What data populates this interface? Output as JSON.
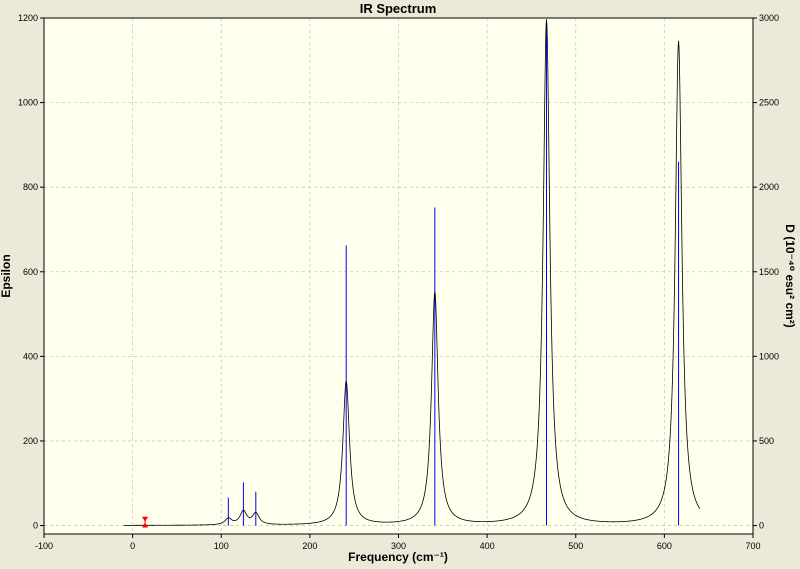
{
  "chart_data": {
    "type": "line",
    "title": "IR Spectrum",
    "xlabel": "Frequency (cm⁻¹)",
    "ylabel": "Epsilon",
    "y2label": "D (10⁻⁴⁰ esu² cm²)",
    "xlim": [
      -100,
      700
    ],
    "ylim": [
      -20,
      1200
    ],
    "y2lim": [
      -50,
      3000
    ],
    "x_ticks": [
      -100,
      0,
      100,
      200,
      300,
      400,
      500,
      600,
      700
    ],
    "y_ticks": [
      0,
      200,
      400,
      600,
      800,
      1000,
      1200
    ],
    "y2_ticks": [
      0,
      500,
      1000,
      1500,
      2000,
      2500,
      3000
    ],
    "grid": true,
    "spectrum_range": [
      -10,
      640
    ],
    "peaks": [
      {
        "x": 108,
        "epsilon": 15,
        "d": 165
      },
      {
        "x": 125,
        "epsilon": 32,
        "d": 255
      },
      {
        "x": 139,
        "epsilon": 27,
        "d": 200
      },
      {
        "x": 241,
        "epsilon": 340,
        "d": 1655
      },
      {
        "x": 341,
        "epsilon": 550,
        "d": 1880
      },
      {
        "x": 467,
        "epsilon": 1195,
        "d": 2990
      },
      {
        "x": 616,
        "epsilon": 1145,
        "d": 2150
      }
    ],
    "marker": {
      "x": 14,
      "d": 40
    },
    "colors": {
      "curve": "#000000",
      "sticks": "#0000ff",
      "marker": "#ff0000",
      "plot_bg": "#ffffee",
      "frame_bg": "#ece9d8"
    }
  }
}
